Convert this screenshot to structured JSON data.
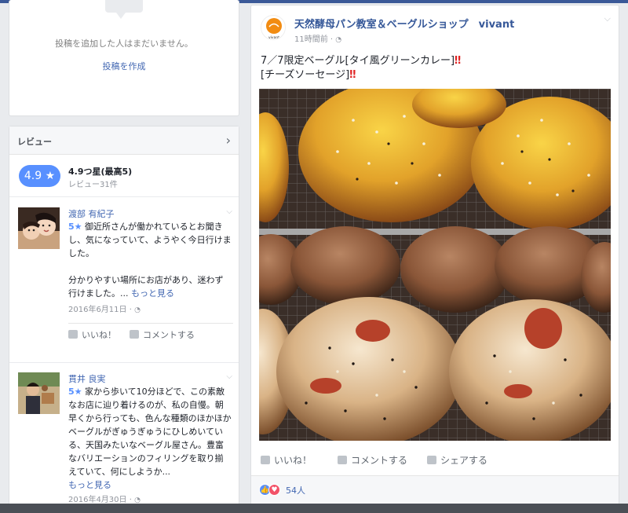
{
  "left": {
    "no_posts": {
      "message": "投稿を追加した人はまだいません。",
      "create_link": "投稿を作成"
    },
    "reviews": {
      "header": "レビュー",
      "rating_pill": "4.9 ★",
      "rating_text": "4.9つ星(最高5)",
      "rating_count": "レビュー31件",
      "items": [
        {
          "name": "渡部 有紀子",
          "stars": "5★",
          "body_1": " 御近所さんが働かれているとお聞きし、気になっていて、ようやく今日行けました。",
          "body_2": "分かりやすい場所にお店があり、迷わず行けました。...",
          "more": "もっと見る",
          "date": "2016年6月11日 ·"
        },
        {
          "name": "貫井 良実",
          "stars": "5★",
          "body_1": " 家から歩いて10分ほどで、この素敵なお店に辿り着けるのが、私の自慢。朝早くから行っても、色んな種類のほかほかベーグルがぎゅうぎゅうにひしめいている、天国みたいなベーグル屋さん。豊富なバリエーションのフィリングを取り揃えていて、何にしようか...",
          "more": "もっと見る",
          "date": "2016年4月30日 ·"
        }
      ],
      "like_label": "いいね！",
      "comment_label": "コメントする"
    }
  },
  "post": {
    "page_name": "天然酵母パン教室＆ベーグルショップ　vivant",
    "logo_text": "vivant",
    "time": "11時間前 ·",
    "line1": "7／7限定ベーグル[タイ風グリーンカレー]",
    "line2": "[チーズソーセージ]",
    "bang": "‼",
    "like_label": "いいね！",
    "comment_label": "コメントする",
    "share_label": "シェアする",
    "likes_count": "54人"
  },
  "colors": {
    "link": "#4267b2",
    "rating_pill": "#5890ff",
    "topbar": "#3b5998",
    "like_react": "#5890ff",
    "love_react": "#f25268"
  }
}
